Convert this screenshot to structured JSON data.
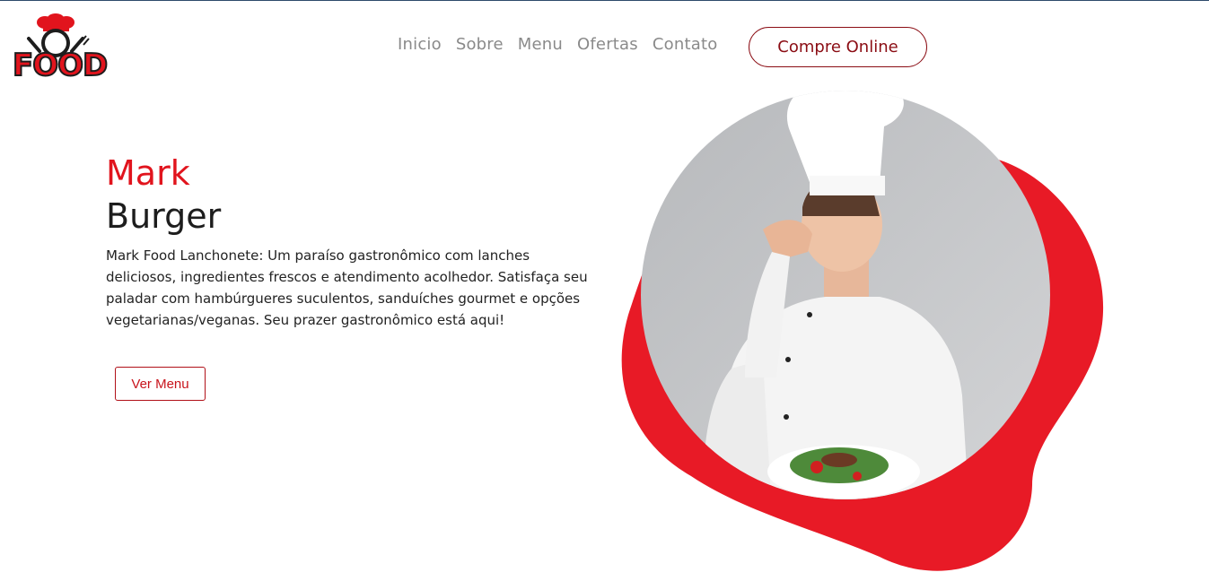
{
  "brand": {
    "logo_text": "FOOD",
    "accent_color": "#e1141d",
    "dark_accent": "#8b0d14"
  },
  "nav": {
    "items": [
      "Inicio",
      "Sobre",
      "Menu",
      "Ofertas",
      "Contato"
    ],
    "cta_label": "Compre Online"
  },
  "hero": {
    "title_line1": "Mark",
    "title_line2": "Burger",
    "description": "Mark Food Lanchonete: Um paraíso gastronômico com lanches deliciosos, ingredientes frescos e atendimento acolhedor. Satisfaça seu paladar com hambúrgueres suculentos, sanduíches gourmet e opções vegetarianas/veganas. Seu prazer gastronômico está aqui!",
    "button_label": "Ver Menu",
    "image_icon": "chef-photo"
  }
}
